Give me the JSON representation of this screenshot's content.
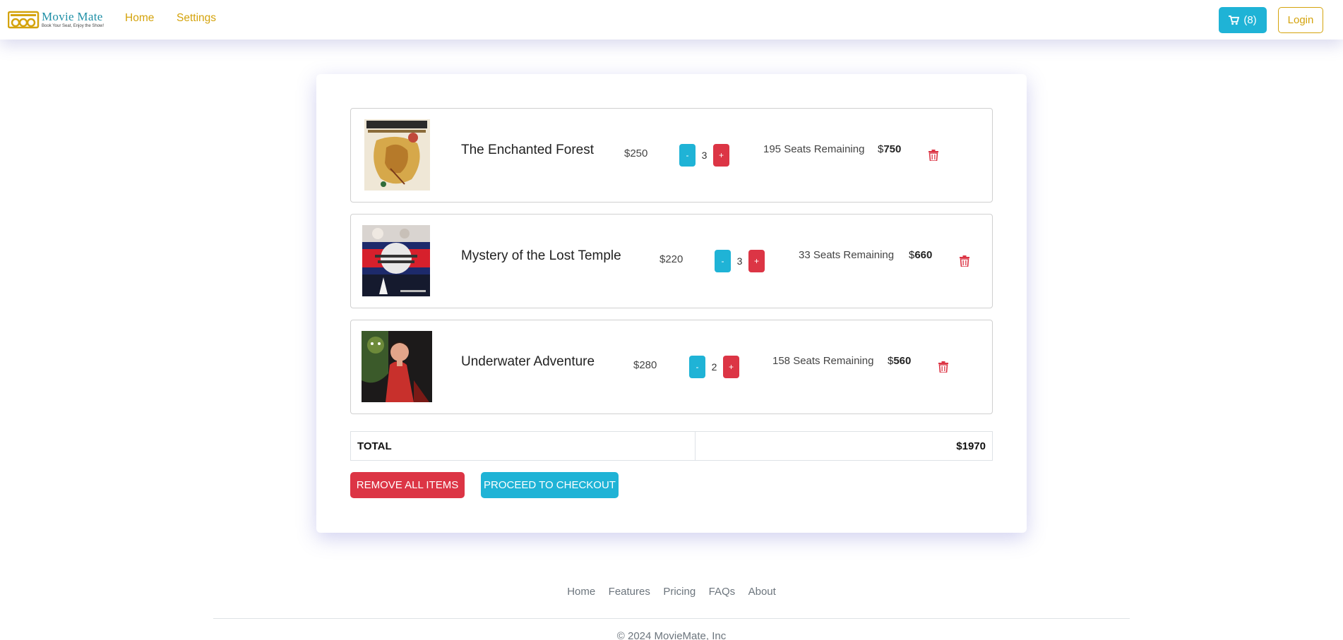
{
  "brand": {
    "name": "Movie Mate",
    "tagline": "Book Your Seat, Enjoy the Show!"
  },
  "nav": {
    "home": "Home",
    "settings": "Settings"
  },
  "header": {
    "cart_count": "(8)",
    "login": "Login"
  },
  "cart": {
    "items": [
      {
        "title": "The Enchanted Forest",
        "price": "$250",
        "quantity": "3",
        "seats": "195 Seats Remaining",
        "currency": "$",
        "line_total": "750"
      },
      {
        "title": "Mystery of the Lost Temple",
        "price": "$220",
        "quantity": "3",
        "seats": "33 Seats Remaining",
        "currency": "$",
        "line_total": "660"
      },
      {
        "title": "Underwater Adventure",
        "price": "$280",
        "quantity": "2",
        "seats": "158 Seats Remaining",
        "currency": "$",
        "line_total": "560"
      }
    ],
    "minus_label": "-",
    "plus_label": "+",
    "total_label": "TOTAL",
    "total_value": "$1970",
    "remove_all": "REMOVE ALL ITEMS",
    "checkout": "PROCEED TO CHECKOUT"
  },
  "footer": {
    "links": [
      "Home",
      "Features",
      "Pricing",
      "FAQs",
      "About"
    ],
    "copyright": "© 2024 MovieMate, Inc"
  },
  "colors": {
    "accent": "#1fb3d6",
    "danger": "#dc3545",
    "brand_gold": "#d4a30c"
  }
}
